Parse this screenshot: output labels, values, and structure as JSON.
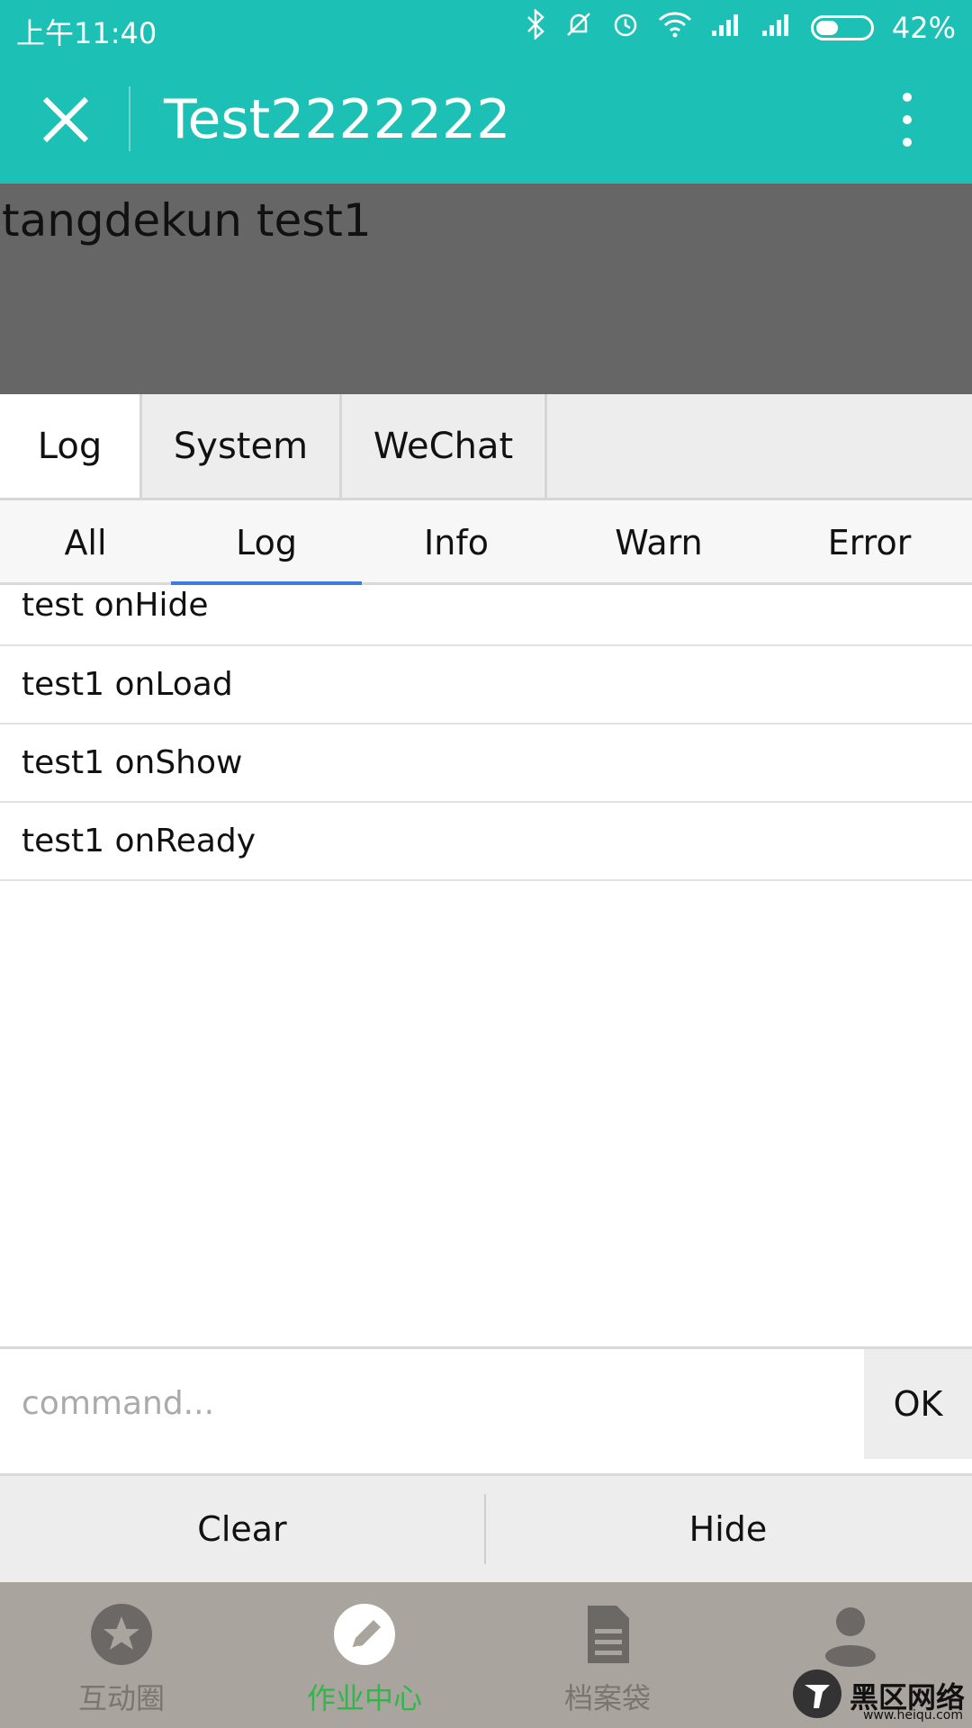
{
  "status": {
    "time": "上午11:40",
    "battery": "42%",
    "battery_level": 0.42
  },
  "nav": {
    "title": "Test2222222"
  },
  "header": {
    "text": "tangdekun test1"
  },
  "panel_tabs": [
    "Log",
    "System",
    "WeChat"
  ],
  "filter_tabs": [
    "All",
    "Log",
    "Info",
    "Warn",
    "Error"
  ],
  "logs": [
    "test onHide",
    "test1 onLoad",
    "test1 onShow",
    "test1 onReady"
  ],
  "command": {
    "placeholder": "command...",
    "ok_label": "OK"
  },
  "actions": {
    "clear": "Clear",
    "hide": "Hide"
  },
  "tabbar": [
    {
      "label": "互动圈",
      "icon": "star-icon"
    },
    {
      "label": "作业中心",
      "icon": "pencil-icon"
    },
    {
      "label": "档案袋",
      "icon": "document-icon"
    },
    {
      "label": "",
      "icon": "person-icon"
    }
  ],
  "watermark": {
    "text": "黑区网络",
    "url": "www.heiqu.com"
  },
  "colors": {
    "accent": "#1dc0b5",
    "active_tab": "#33b54a",
    "underline": "#3d7be0"
  }
}
